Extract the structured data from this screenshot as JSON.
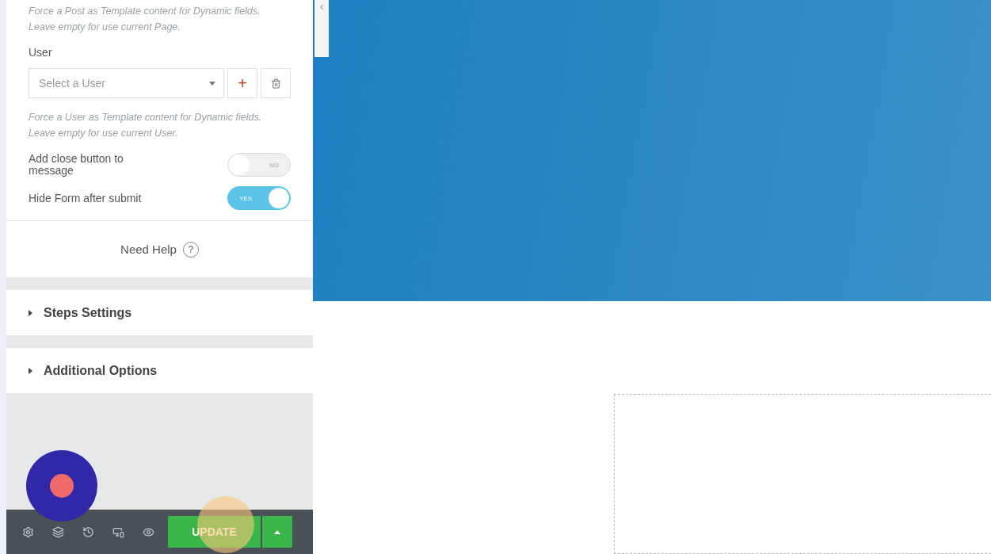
{
  "post_note": "Force a Post as Template content for Dynamic fields. Leave empty for use current Page.",
  "user_field": {
    "label": "User",
    "placeholder": "Select a User",
    "add_symbol": "+",
    "note": "Force a User as Template content for Dynamic fields. Leave empty for use current User."
  },
  "switches": [
    {
      "label": "Add close button to message",
      "on": false,
      "text": "NO"
    },
    {
      "label": "Hide Form after submit",
      "on": true,
      "text": "YES"
    }
  ],
  "help": {
    "label": "Need Help",
    "icon_text": "?"
  },
  "sections": [
    {
      "title": "Steps Settings",
      "expanded": false
    },
    {
      "title": "Additional Options",
      "expanded": false
    }
  ],
  "footer": {
    "update_label": "UPDATE"
  }
}
